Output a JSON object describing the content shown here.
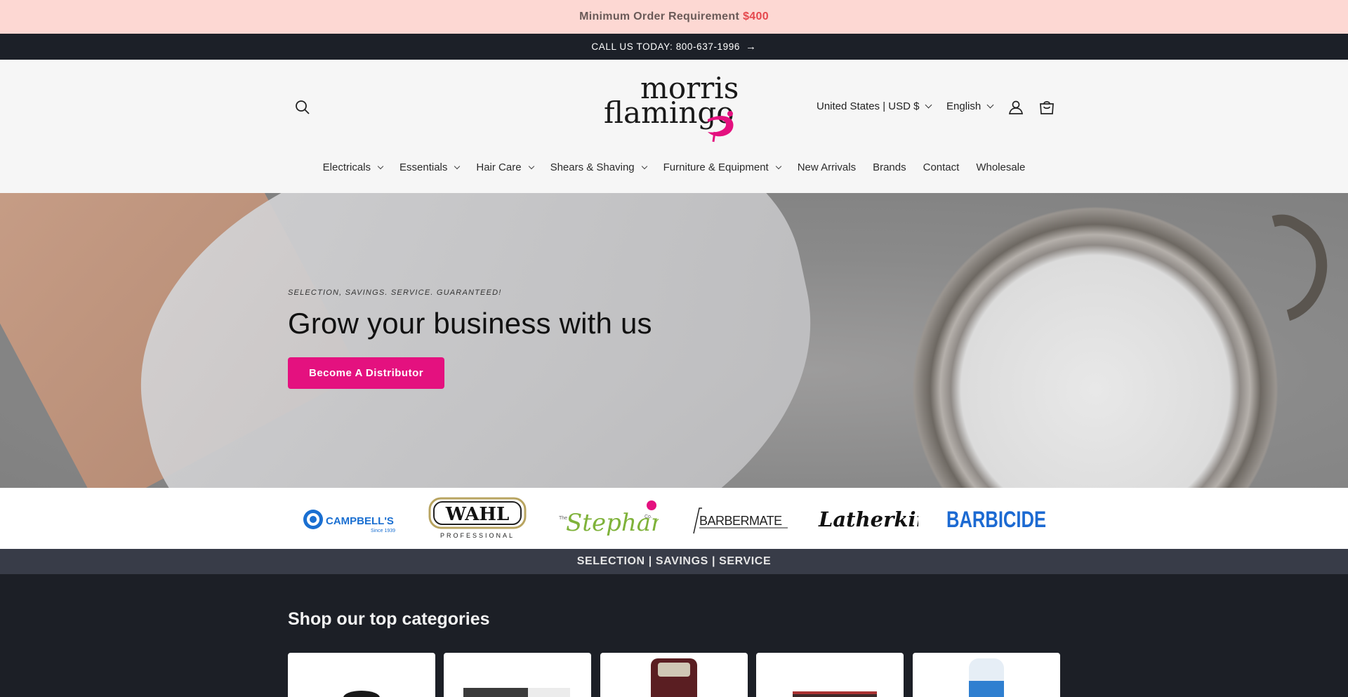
{
  "announcement": {
    "text": "Minimum Order Requirement",
    "amount": "$400"
  },
  "call_bar": {
    "text": "CALL US TODAY: 800-637-1996",
    "arrow": "→"
  },
  "header": {
    "logo_text_top": "morris",
    "logo_text_bottom": "flamingo",
    "locale": "United States | USD $",
    "language": "English",
    "icons": [
      "search-icon",
      "account-icon",
      "cart-icon"
    ]
  },
  "nav": {
    "items": [
      {
        "label": "Electricals",
        "dropdown": true
      },
      {
        "label": "Essentials",
        "dropdown": true
      },
      {
        "label": "Hair Care",
        "dropdown": true
      },
      {
        "label": "Shears & Shaving",
        "dropdown": true
      },
      {
        "label": "Furniture & Equipment",
        "dropdown": true
      },
      {
        "label": "New Arrivals",
        "dropdown": false
      },
      {
        "label": "Brands",
        "dropdown": false
      },
      {
        "label": "Contact",
        "dropdown": false
      },
      {
        "label": "Wholesale",
        "dropdown": false
      }
    ]
  },
  "hero": {
    "tagline": "SELECTION, SAVINGS. SERVICE. GUARANTEED!",
    "title": "Grow your business with us",
    "cta": "Become A Distributor"
  },
  "brands": {
    "items": [
      {
        "name": "CAMPBELL'S",
        "sub": "Since 1939"
      },
      {
        "name": "WAHL",
        "sub": "PROFESSIONAL"
      },
      {
        "name": "Stephan",
        "sub": "The",
        "suffix": "Co."
      },
      {
        "name": "BARBERMATE"
      },
      {
        "name": "Latherking"
      },
      {
        "name": "BARBICIDE"
      }
    ]
  },
  "service_strip": {
    "text": "SELECTION | SAVINGS | SERVICE"
  },
  "categories": {
    "title": "Shop our top categories"
  },
  "colors": {
    "accent": "#e4117f",
    "promo_bg": "#fdd8d3",
    "promo_amount": "#e5484d",
    "dark": "#1c1f26"
  }
}
